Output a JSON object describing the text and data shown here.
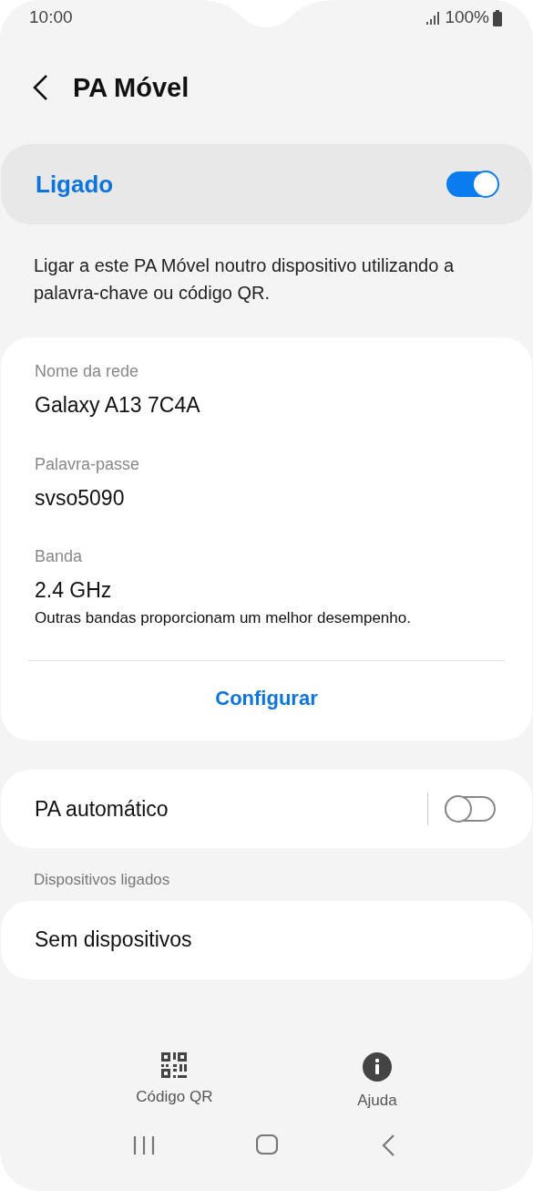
{
  "status_bar": {
    "time": "10:00",
    "battery": "100%"
  },
  "header": {
    "title": "PA Móvel"
  },
  "master_switch": {
    "label": "Ligado",
    "on": true
  },
  "description": "Ligar a este PA Móvel noutro dispositivo utilizando a palavra-chave ou código QR.",
  "details": {
    "fields": [
      {
        "label": "Nome da rede",
        "value": "Galaxy A13 7C4A"
      },
      {
        "label": "Palavra-passe",
        "value": "svso5090"
      },
      {
        "label": "Banda",
        "value": "2.4 GHz",
        "note": "Outras bandas proporcionam um melhor desempenho."
      }
    ],
    "button": "Configurar"
  },
  "auto_hotspot": {
    "label": "PA automático",
    "on": false
  },
  "connected_devices": {
    "heading": "Dispositivos ligados",
    "empty_text": "Sem dispositivos"
  },
  "bottom_actions": [
    {
      "label": "Código QR",
      "kind": "qr"
    },
    {
      "label": "Ajuda",
      "kind": "info"
    }
  ]
}
